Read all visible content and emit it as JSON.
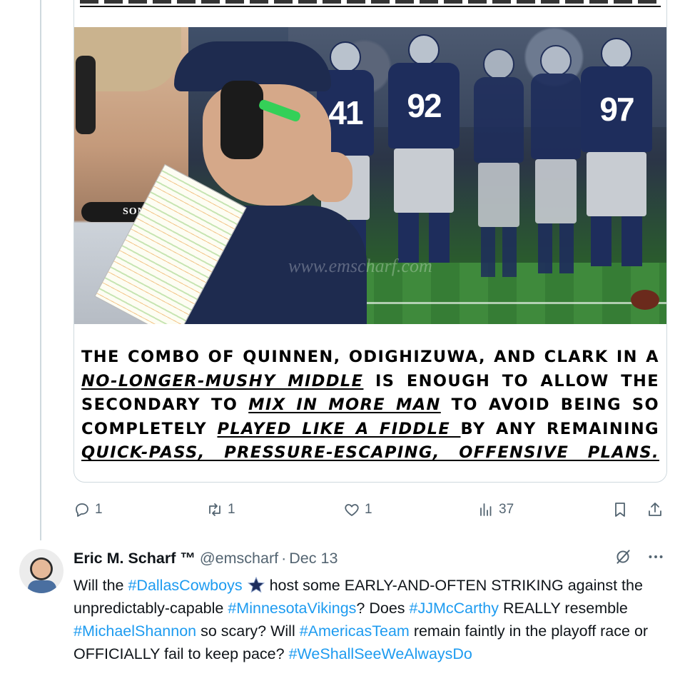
{
  "post": {
    "image": {
      "mic_brand": "SONY",
      "watermark": "www.emscharf.com",
      "jersey_numbers": [
        "41",
        "92",
        "97"
      ]
    },
    "caption": {
      "p1": "THE COMBO OF QUINNEN, ODIGHIZUWA, AND CLARK IN A ",
      "e1": "NO-LONGER-MUSHY MIDDLE",
      "p2": " IS ENOUGH TO ALLOW THE SECONDARY TO ",
      "e2": "MIX IN MORE MAN",
      "p3": " TO AVOID BEING SO COMPLETELY ",
      "e3": "PLAYED LIKE A FIDDLE ",
      "p4": "BY ANY REMAINING ",
      "e4": "QUICK-PASS, PRESSURE-ESCAPING, OFFENSIVE PLANS."
    },
    "actions": {
      "replies": "1",
      "reposts": "1",
      "likes": "1",
      "views": "37"
    }
  },
  "reply": {
    "author_name": "Eric M. Scharf ™",
    "handle": "@emscharf",
    "separator": "·",
    "date": "Dec 13",
    "text": {
      "t1": "Will the ",
      "h1": "#DallasCowboys",
      "t2": " host some EARLY-AND-OFTEN STRIKING against the unpredictably-capable ",
      "h2": "#MinnesotaVikings",
      "t3": "? Does ",
      "h3": "#JJMcCarthy",
      "t4": " REALLY resemble ",
      "h4": "#MichaelShannon",
      "t5": " so scary? Will ",
      "h5": "#AmericasTeam",
      "t6": " remain faintly in the playoff race or OFFICIALLY fail to keep pace? ",
      "h6": "#WeShallSeeWeAlwaysDo"
    }
  },
  "icons": {
    "reply": "reply-icon",
    "repost": "repost-icon",
    "like": "heart-icon",
    "views": "views-icon",
    "bookmark": "bookmark-icon",
    "share": "share-icon",
    "grok": "grok-icon",
    "more": "more-icon",
    "star": "star-icon"
  },
  "colors": {
    "link": "#1d9bf0",
    "muted": "#536471",
    "text": "#0f1419",
    "border": "#cfd9de"
  }
}
